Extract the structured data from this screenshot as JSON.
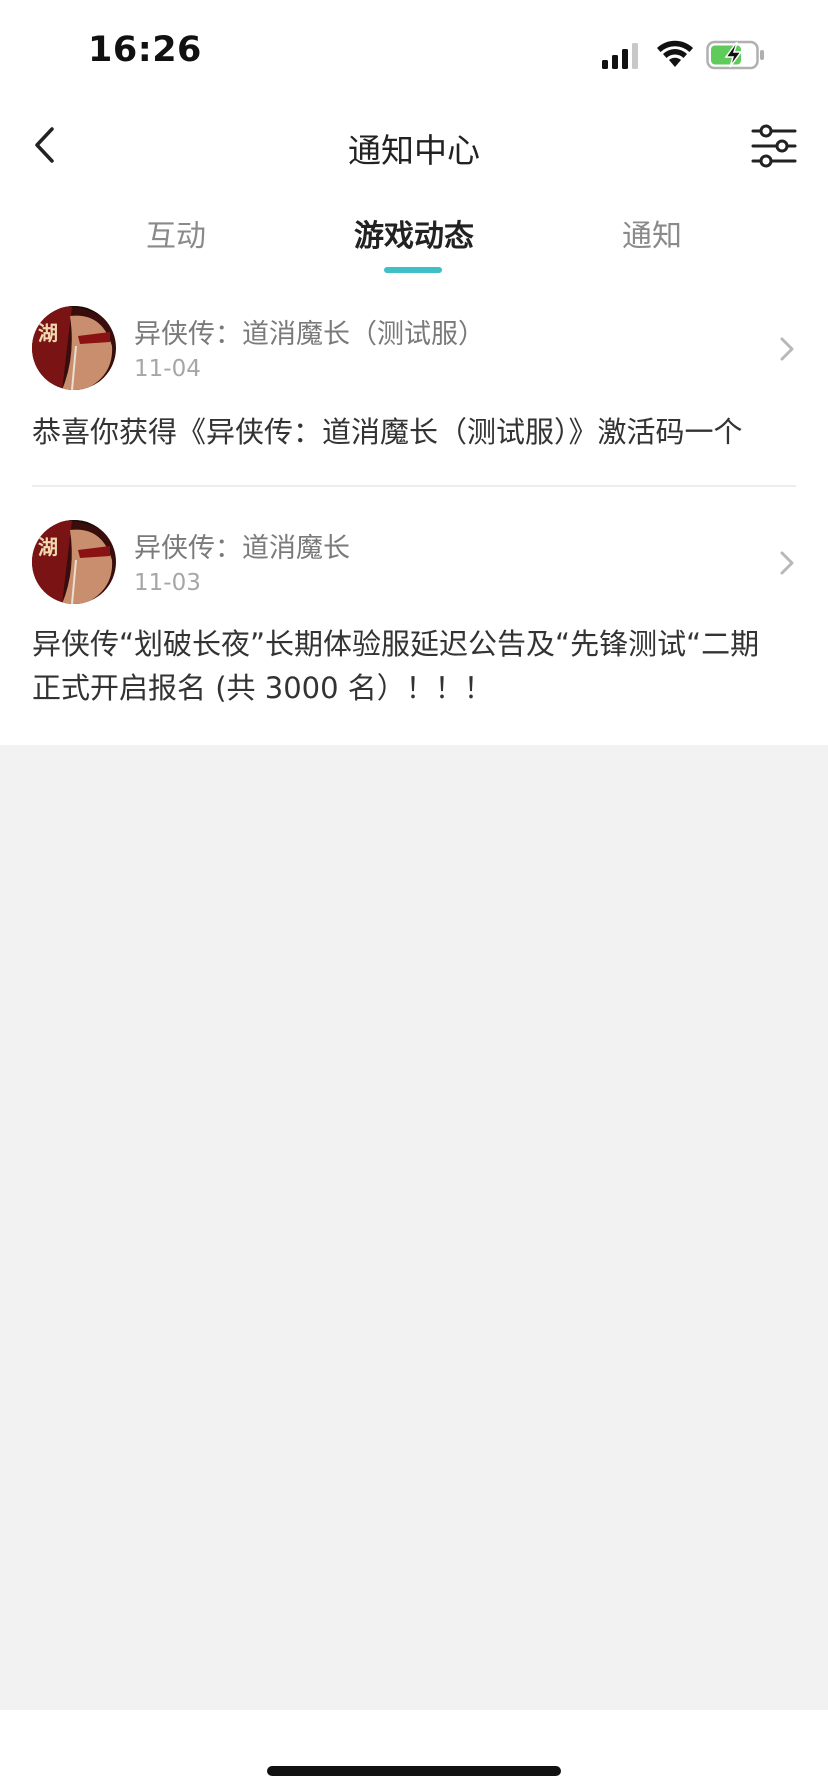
{
  "status": {
    "time": "16:26",
    "battery_color": "#5ecb5a"
  },
  "nav": {
    "title": "通知中心",
    "back_icon": "chevron-left-icon",
    "filter_icon": "sliders-icon"
  },
  "tabs": [
    {
      "label": "互动",
      "active": false
    },
    {
      "label": "游戏动态",
      "active": true
    },
    {
      "label": "通知",
      "active": false
    }
  ],
  "accent_color": "#3fbfc8",
  "notifications": [
    {
      "game_name": "异侠传：道消魔长（测试服）",
      "date": "11-04",
      "content": "恭喜你获得《异侠传：道消魔长（测试服）》激活码一个"
    },
    {
      "game_name": "异侠传：道消魔长",
      "date": "11-03",
      "content_line1": "异侠传“划破长夜”长期体验服延迟公告及“先锋测试“二期",
      "content_line2": "正式开启报名 (共 3000 名）！！！"
    }
  ]
}
